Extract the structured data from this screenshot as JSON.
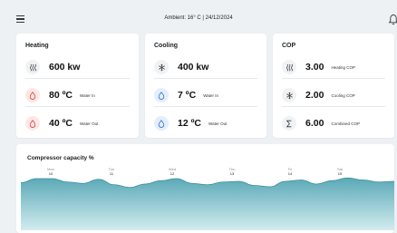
{
  "topbar": {
    "ambient_text": "Ambient: 16° C | 24/12/2024",
    "menu_icon": "hamburger-menu-icon",
    "bell_icon": "bell-icon"
  },
  "heating": {
    "title": "Heating",
    "power": "600 kw",
    "water_in_temp": "80 ºC",
    "water_in_label": "Water In",
    "water_out_temp": "40 ºC",
    "water_out_label": "Water Out",
    "icons": [
      "heat-waves-icon",
      "water-drop-icon",
      "water-drop-icon"
    ]
  },
  "cooling": {
    "title": "Cooling",
    "power": "400 kw",
    "water_in_temp": "7 ºC",
    "water_in_label": "Water In",
    "water_out_temp": "12 ºC",
    "water_out_label": "Water Out",
    "icons": [
      "snowflake-icon",
      "water-drop-icon",
      "water-drop-icon"
    ]
  },
  "cop": {
    "title": "COP",
    "heating_cop_value": "3.00",
    "heating_cop_label": "Heating COP",
    "cooling_cop_value": "2.00",
    "cooling_cop_label": "Cooling COP",
    "combined_cop_value": "6.00",
    "combined_cop_label": "Combined COP",
    "icons": [
      "heat-waves-icon",
      "snowflake-icon",
      "sigma-icon"
    ]
  },
  "colors": {
    "heat_accent": "#e53935",
    "cool_accent": "#2f6fd6",
    "chart_fill_top": "#5aa9b7",
    "chart_fill_bottom": "#d3ecef"
  },
  "chart_data": {
    "type": "area",
    "title": "Compressor capacity %",
    "days": [
      {
        "weekday": "Mon",
        "date": "10"
      },
      {
        "weekday": "Tue",
        "date": "11"
      },
      {
        "weekday": "Wed",
        "date": "12"
      },
      {
        "weekday": "Thu",
        "date": "13"
      },
      {
        "weekday": "Fri",
        "date": "14"
      },
      {
        "weekday": "Sat",
        "date": "15"
      }
    ],
    "x": [
      0,
      0.25,
      0.5,
      0.75,
      1,
      1.25,
      1.5,
      1.75,
      2,
      2.25,
      2.5,
      2.75,
      3,
      3.25,
      3.5,
      3.75,
      4,
      4.25,
      4.5,
      4.75,
      5,
      5.25,
      5.5,
      5.75,
      6
    ],
    "values": [
      70,
      76,
      76,
      71,
      69,
      75,
      67,
      63,
      68,
      73,
      76,
      69,
      67,
      71,
      72,
      66,
      64,
      72,
      74,
      68,
      73,
      77,
      74,
      71,
      72
    ],
    "ylim": [
      0,
      100
    ],
    "grid": false
  }
}
